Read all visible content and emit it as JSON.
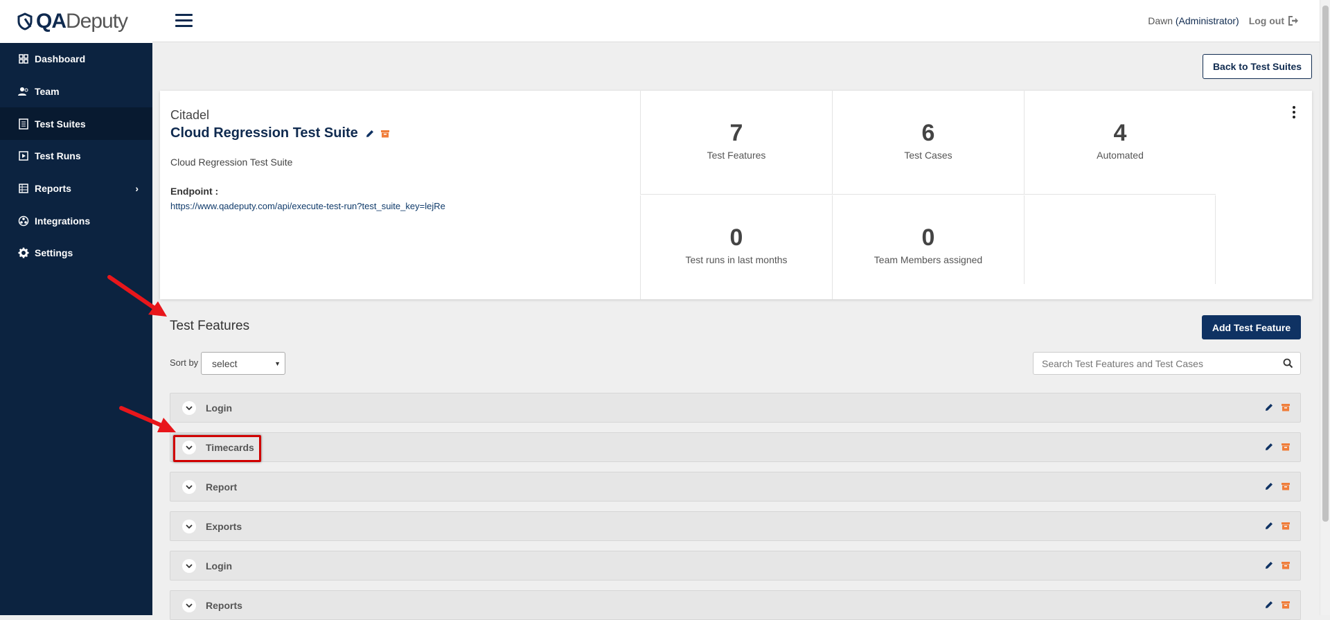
{
  "app": {
    "brand_bold": "QA",
    "brand_thin": "Deputy"
  },
  "sidebar": {
    "items": [
      {
        "label": "Dashboard",
        "icon": "dashboard-icon"
      },
      {
        "label": "Team",
        "icon": "team-icon"
      },
      {
        "label": "Test Suites",
        "icon": "test-suites-icon",
        "active": true
      },
      {
        "label": "Test Runs",
        "icon": "play-icon"
      },
      {
        "label": "Reports",
        "icon": "table-icon",
        "has_submenu": true
      },
      {
        "label": "Integrations",
        "icon": "integrations-icon"
      },
      {
        "label": "Settings",
        "icon": "gear-icon"
      }
    ]
  },
  "header": {
    "user_name": "Dawn",
    "user_role": "(Administrator)",
    "logout": "Log out"
  },
  "toolbar": {
    "back_label": "Back to Test Suites"
  },
  "suite": {
    "project": "Citadel",
    "title": "Cloud Regression Test Suite",
    "description": "Cloud Regression Test Suite",
    "endpoint_label": "Endpoint :",
    "endpoint_url": "https://www.qadeputy.com/api/execute-test-run?test_suite_key=lejRe"
  },
  "stats": [
    {
      "value": "7",
      "label": "Test Features"
    },
    {
      "value": "6",
      "label": "Test Cases"
    },
    {
      "value": "4",
      "label": "Automated"
    },
    {
      "value": "0",
      "label": "Test runs in last months"
    },
    {
      "value": "0",
      "label": "Team Members assigned"
    }
  ],
  "features": {
    "title": "Test Features",
    "add_label": "Add Test Feature",
    "sort_label": "Sort by",
    "sort_value": "select",
    "search_placeholder": "Search Test Features and Test Cases",
    "items": [
      "Login",
      "Timecards",
      "Report",
      "Exports",
      "Login",
      "Reports"
    ]
  },
  "colors": {
    "navy": "#0c2340",
    "accent": "#0f3263",
    "archive": "#f07d3a",
    "annotation": "#d00000"
  }
}
